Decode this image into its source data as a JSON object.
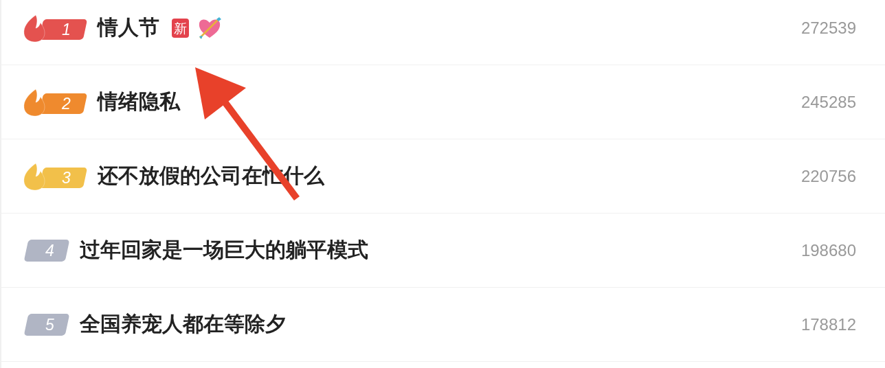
{
  "items": [
    {
      "rank": "1",
      "kind": "hot",
      "color": "#e4524f",
      "title": "情人节",
      "tag": "新",
      "decorated": true,
      "count": "272539"
    },
    {
      "rank": "2",
      "kind": "hot",
      "color": "#ef8a2e",
      "title": "情绪隐私",
      "decorated": false,
      "count": "245285"
    },
    {
      "rank": "3",
      "kind": "hot",
      "color": "#f2c04a",
      "title": "还不放假的公司在忙什么",
      "decorated": false,
      "count": "220756"
    },
    {
      "rank": "4",
      "kind": "plain",
      "color": "#b0b5c4",
      "title": "过年回家是一场巨大的躺平模式",
      "decorated": false,
      "count": "198680"
    },
    {
      "rank": "5",
      "kind": "plain",
      "color": "#b0b5c4",
      "title": "全国养宠人都在等除夕",
      "decorated": false,
      "count": "178812"
    }
  ],
  "annotation": {
    "kind": "arrow",
    "color": "#e8412a"
  }
}
